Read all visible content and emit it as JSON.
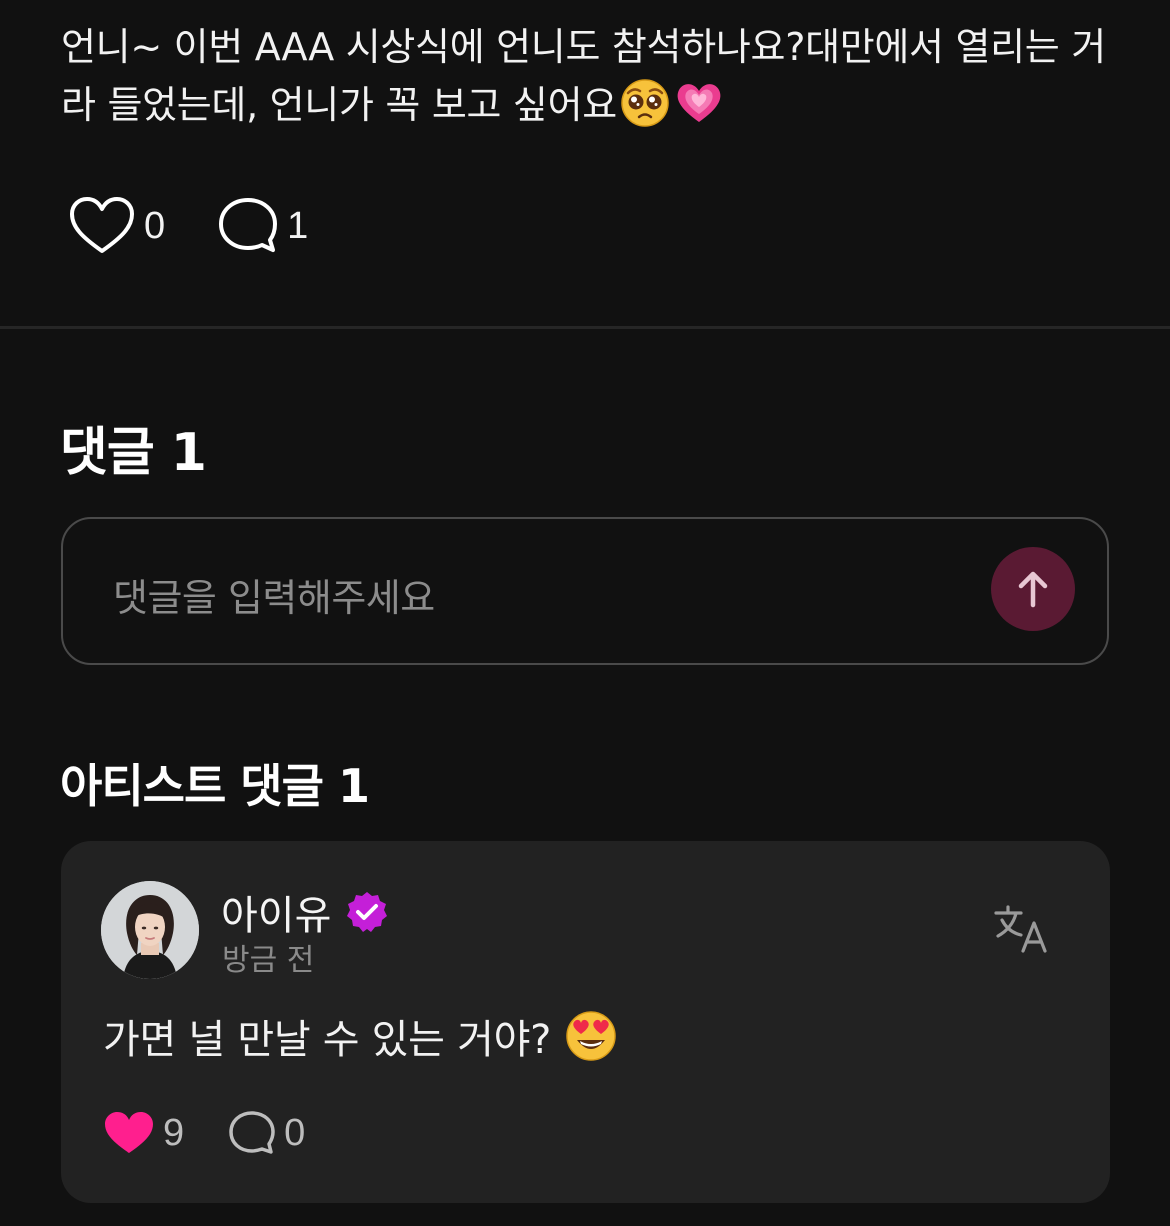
{
  "post": {
    "text": "언니~ 이번 AAA 시상식에 언니도 참석하나요?대만에서 열리는 거라 들었는데, 언니가 꼭 보고 싶어요",
    "emojis": [
      "pleading-face-emoji",
      "growing-heart-emoji"
    ],
    "like_count": "0",
    "comment_count": "1"
  },
  "comments": {
    "heading": "댓글 1",
    "input_placeholder": "댓글을 입력해주세요",
    "send_icon": "arrow-up-icon"
  },
  "artist_comments": {
    "heading": "아티스트 댓글 1",
    "items": [
      {
        "author": "아이유",
        "verified": true,
        "time": "방금 전",
        "text": "가면 널 만날 수 있는 거야?",
        "emoji": "heart-eyes-emoji",
        "like_count": "9",
        "reply_count": "0",
        "liked": true
      }
    ]
  },
  "colors": {
    "background": "#111111",
    "card": "#222222",
    "accent_pink": "#ff1f8e",
    "verified_purple": "#c41fd8",
    "send_button": "#5a1a33"
  }
}
